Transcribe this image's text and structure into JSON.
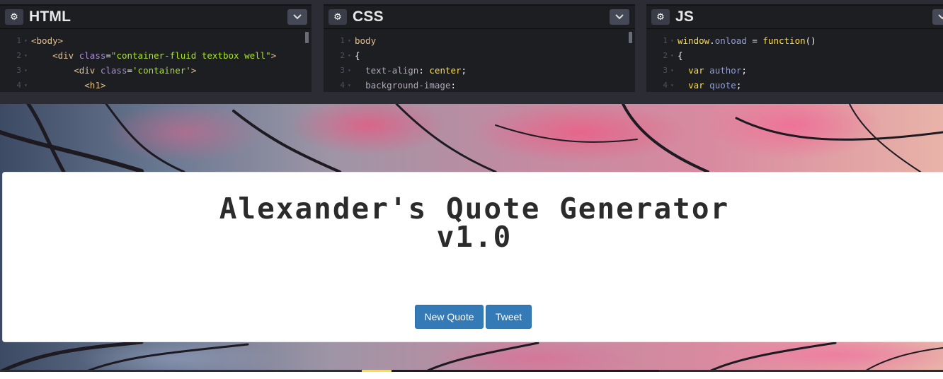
{
  "editors": {
    "html": {
      "title": "HTML",
      "lines": [
        {
          "num": "1",
          "indent": "",
          "parts": [
            {
              "t": "<body>",
              "c": "tag"
            }
          ]
        },
        {
          "num": "2",
          "indent": "    ",
          "parts": [
            {
              "t": "<div ",
              "c": "tag"
            },
            {
              "t": "class",
              "c": "attr"
            },
            {
              "t": "=",
              "c": "txt"
            },
            {
              "t": "\"container-fluid textbox well\"",
              "c": "str"
            },
            {
              "t": ">",
              "c": "tag"
            }
          ]
        },
        {
          "num": "3",
          "indent": "        ",
          "parts": [
            {
              "t": "<div ",
              "c": "tag"
            },
            {
              "t": "class",
              "c": "attr"
            },
            {
              "t": "=",
              "c": "txt"
            },
            {
              "t": "'container'",
              "c": "str"
            },
            {
              "t": ">",
              "c": "tag"
            }
          ]
        },
        {
          "num": "4",
          "indent": "          ",
          "parts": [
            {
              "t": "<h1>",
              "c": "tag"
            }
          ]
        }
      ]
    },
    "css": {
      "title": "CSS",
      "lines": [
        {
          "num": "1",
          "indent": "",
          "parts": [
            {
              "t": "body",
              "c": "tag"
            }
          ]
        },
        {
          "num": "2",
          "indent": "",
          "parts": [
            {
              "t": "{",
              "c": "txt"
            }
          ]
        },
        {
          "num": "3",
          "indent": "  ",
          "parts": [
            {
              "t": "text-align",
              "c": "prop"
            },
            {
              "t": ": ",
              "c": "txt"
            },
            {
              "t": "center",
              "c": "val"
            },
            {
              "t": ";",
              "c": "txt"
            }
          ]
        },
        {
          "num": "4",
          "indent": "  ",
          "parts": [
            {
              "t": "background-image",
              "c": "prop"
            },
            {
              "t": ":",
              "c": "txt"
            }
          ]
        }
      ]
    },
    "js": {
      "title": "JS",
      "lines": [
        {
          "num": "1",
          "indent": "",
          "parts": [
            {
              "t": "window",
              "c": "kw"
            },
            {
              "t": ".",
              "c": "txt"
            },
            {
              "t": "onload",
              "c": "var"
            },
            {
              "t": " = ",
              "c": "txt"
            },
            {
              "t": "function",
              "c": "kw"
            },
            {
              "t": "()",
              "c": "txt"
            }
          ]
        },
        {
          "num": "2",
          "indent": "",
          "parts": [
            {
              "t": "{",
              "c": "txt"
            }
          ]
        },
        {
          "num": "3",
          "indent": "  ",
          "parts": [
            {
              "t": "var ",
              "c": "kw"
            },
            {
              "t": "author",
              "c": "var"
            },
            {
              "t": ";",
              "c": "txt"
            }
          ]
        },
        {
          "num": "4",
          "indent": "  ",
          "parts": [
            {
              "t": "var ",
              "c": "kw"
            },
            {
              "t": "quote",
              "c": "var"
            },
            {
              "t": ";",
              "c": "txt"
            }
          ]
        }
      ]
    }
  },
  "preview": {
    "title_line1": "Alexander's Quote Generator",
    "title_line2": "v1.0",
    "new_quote_label": "New Quote",
    "tweet_label": "Tweet"
  },
  "progress": {
    "fraction": 0.1
  },
  "icons": {
    "settings": "gear-icon",
    "collapse": "chevron-down-icon"
  },
  "colors": {
    "button": "#337ab7",
    "progress": "#ffdd40",
    "editor_bg": "#1d1e22"
  }
}
